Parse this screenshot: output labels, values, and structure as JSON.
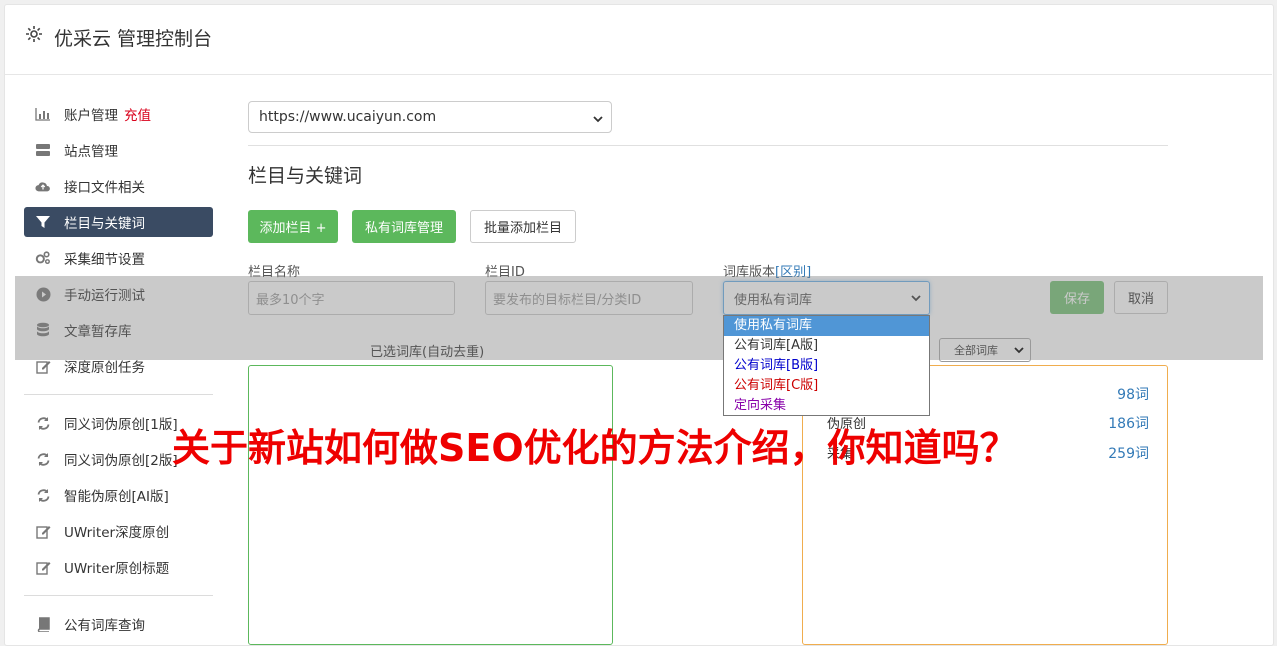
{
  "header": {
    "title": "优采云 管理控制台",
    "icon": "gear-icon"
  },
  "sidebar": {
    "items": [
      {
        "label": "账户管理",
        "badge": "充值",
        "icon": "bar-chart-icon"
      },
      {
        "label": "站点管理",
        "icon": "server-icon"
      },
      {
        "label": "接口文件相关",
        "icon": "cloud-upload-icon"
      },
      {
        "label": "栏目与关键词",
        "icon": "filter-icon",
        "active": true
      },
      {
        "label": "采集细节设置",
        "icon": "cogs-icon"
      },
      {
        "label": "手动运行测试",
        "icon": "play-circle-icon"
      },
      {
        "label": "文章暂存库",
        "icon": "database-icon"
      },
      {
        "label": "深度原创任务",
        "icon": "edit-icon"
      },
      {
        "label": "同义词伪原创[1版]",
        "icon": "refresh-icon"
      },
      {
        "label": "同义词伪原创[2版]",
        "icon": "refresh-icon"
      },
      {
        "label": "智能伪原创[AI版]",
        "icon": "refresh-icon"
      },
      {
        "label": "UWriter深度原创",
        "icon": "edit-icon"
      },
      {
        "label": "UWriter原创标题",
        "icon": "edit-icon"
      },
      {
        "label": "公有词库查询",
        "icon": "book-icon"
      }
    ]
  },
  "main": {
    "site_select": "https://www.ucaiyun.com",
    "section_title": "栏目与关键词",
    "buttons": {
      "add": "添加栏目 +",
      "private_lib": "私有词库管理",
      "batch_add": "批量添加栏目"
    },
    "form": {
      "name_label": "栏目名称",
      "name_placeholder": "最多10个字",
      "id_label": "栏目ID",
      "id_placeholder": "要发布的目标栏目/分类ID",
      "version_label": "词库版本",
      "version_link": "[区别]",
      "version_value": "使用私有词库",
      "save": "保存",
      "cancel": "取消"
    },
    "dropdown_options": [
      {
        "label": "使用私有词库",
        "color": "#ffffff",
        "selected": true
      },
      {
        "label": "公有词库[A版]",
        "color": "#333333"
      },
      {
        "label": "公有词库[B版]",
        "color": "#0000cc"
      },
      {
        "label": "公有词库[C版]",
        "color": "#cc0000"
      },
      {
        "label": "定向采集",
        "color": "#8800aa"
      }
    ],
    "selected_lib_label": "已选词库(自动去重)",
    "all_lib_select": "全部词库",
    "libraries": [
      {
        "name": "",
        "count": "98词"
      },
      {
        "name": "伪原创",
        "count": "186词"
      },
      {
        "name": "采集",
        "count": "259词"
      }
    ]
  },
  "watermark": "关于新站如何做SEO优化的方法介绍，你知道吗？",
  "colors": {
    "accent_green": "#5cb85c",
    "active_nav": "#3a4b63",
    "link": "#337ab7",
    "watermark": "#ee0000"
  }
}
